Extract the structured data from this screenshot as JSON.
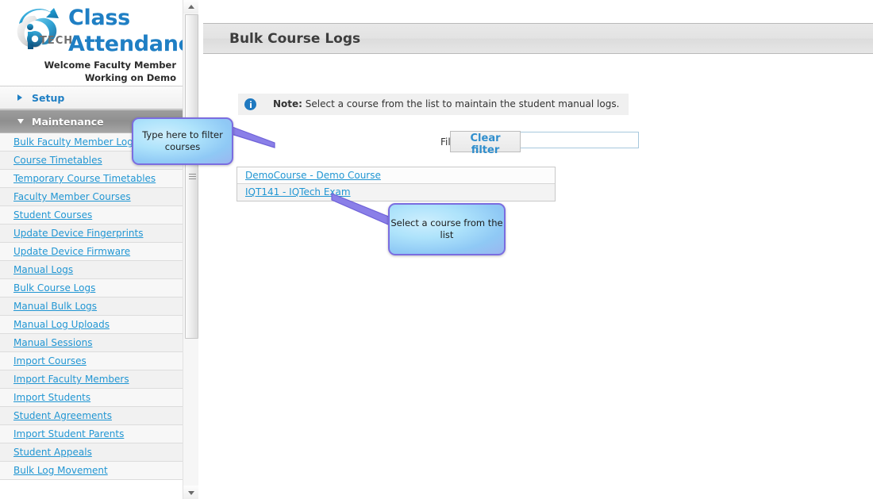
{
  "brand": {
    "logo_icon": "iqtech-logo-icon",
    "title_line1": "Class",
    "title_line2": "Attendance",
    "welcome_line1": "Welcome Faculty Member",
    "welcome_line2": "Working on Demo",
    "accent_color": "#1f7fc4",
    "link_color": "#2196d3"
  },
  "sidebar": {
    "sections": [
      {
        "label": "Setup",
        "expanded": false,
        "icon": "chevron-right-icon"
      },
      {
        "label": "Maintenance",
        "expanded": true,
        "icon": "chevron-down-icon"
      }
    ],
    "items": [
      {
        "label": "Bulk Faculty Member Logs"
      },
      {
        "label": "Course Timetables"
      },
      {
        "label": "Temporary Course Timetables"
      },
      {
        "label": "Faculty Member Courses"
      },
      {
        "label": "Student Courses"
      },
      {
        "label": "Update Device Fingerprints"
      },
      {
        "label": "Update Device Firmware"
      },
      {
        "label": "Manual Logs"
      },
      {
        "label": "Bulk Course Logs"
      },
      {
        "label": "Manual Bulk Logs"
      },
      {
        "label": "Manual Log Uploads"
      },
      {
        "label": "Manual Sessions"
      },
      {
        "label": "Import Courses"
      },
      {
        "label": "Import Faculty Members"
      },
      {
        "label": "Import Students"
      },
      {
        "label": "Student Agreements"
      },
      {
        "label": "Import Student Parents"
      },
      {
        "label": "Student Appeals"
      },
      {
        "label": "Bulk Log Movement"
      }
    ]
  },
  "scrollbar": {
    "up_icon": "scroll-up-arrow-icon",
    "down_icon": "scroll-down-arrow-icon",
    "thumb_grip_icon": "scrollbar-grip-icon"
  },
  "main": {
    "page_title": "Bulk Course Logs",
    "note": {
      "icon": "info-icon",
      "prefix": "Note:",
      "text": "Select a course from the list to maintain the student manual logs."
    },
    "filter": {
      "label": "Filter:",
      "value": "",
      "placeholder": "",
      "clear_button": "Clear filter"
    },
    "course_list": [
      {
        "label": "DemoCourse - Demo Course"
      },
      {
        "label": "IQT141 - IQTech Exam"
      }
    ]
  },
  "callouts": [
    {
      "text": "Type here to filter courses",
      "target": "filter-input"
    },
    {
      "text": "Select a course from the list",
      "target": "course-list"
    }
  ]
}
